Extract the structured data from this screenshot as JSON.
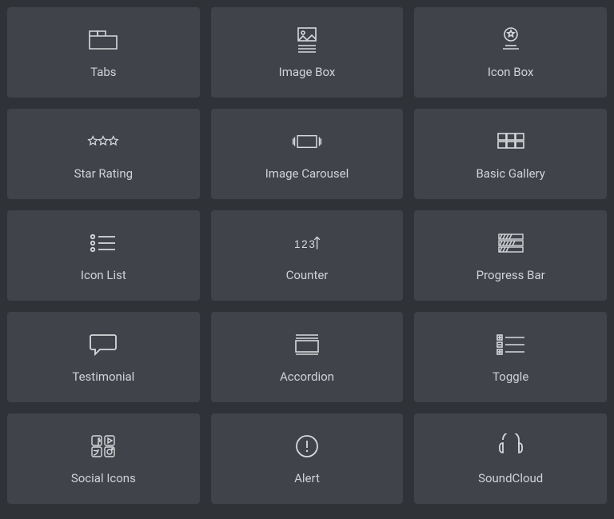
{
  "widgets": [
    {
      "label": "Tabs",
      "icon": "tabs"
    },
    {
      "label": "Image Box",
      "icon": "image-box"
    },
    {
      "label": "Icon Box",
      "icon": "icon-box"
    },
    {
      "label": "Star Rating",
      "icon": "star-rating"
    },
    {
      "label": "Image Carousel",
      "icon": "image-carousel"
    },
    {
      "label": "Basic Gallery",
      "icon": "basic-gallery"
    },
    {
      "label": "Icon List",
      "icon": "icon-list"
    },
    {
      "label": "Counter",
      "icon": "counter"
    },
    {
      "label": "Progress Bar",
      "icon": "progress-bar"
    },
    {
      "label": "Testimonial",
      "icon": "testimonial"
    },
    {
      "label": "Accordion",
      "icon": "accordion"
    },
    {
      "label": "Toggle",
      "icon": "toggle"
    },
    {
      "label": "Social Icons",
      "icon": "social-icons"
    },
    {
      "label": "Alert",
      "icon": "alert"
    },
    {
      "label": "SoundCloud",
      "icon": "soundcloud"
    }
  ]
}
